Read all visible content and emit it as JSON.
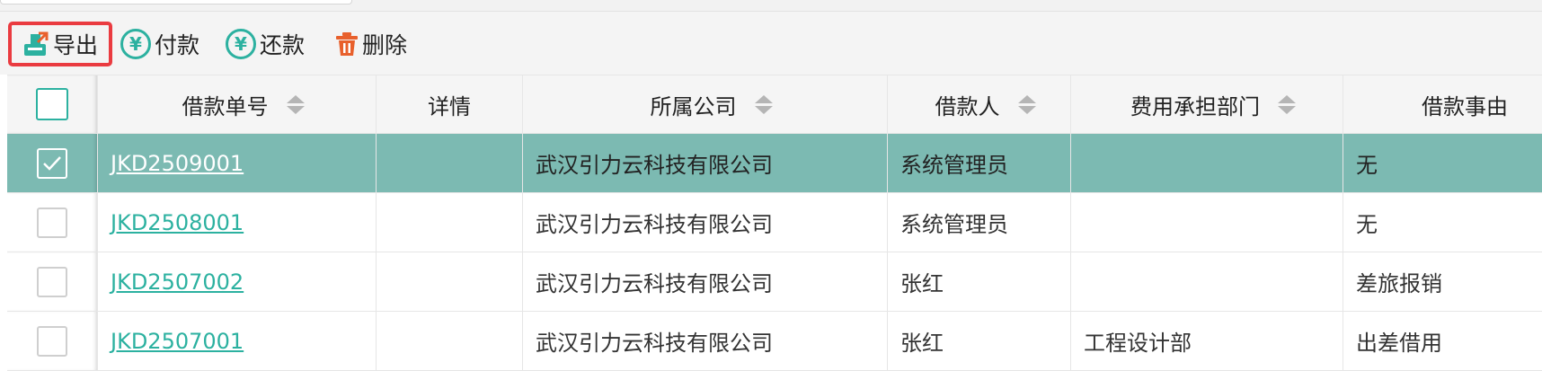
{
  "toolbar": {
    "export_label": "导出",
    "pay_label": "付款",
    "repay_label": "还款",
    "delete_label": "删除"
  },
  "table": {
    "headers": {
      "loan_no": "借款单号",
      "detail": "详情",
      "company": "所属公司",
      "borrower": "借款人",
      "dept": "费用承担部门",
      "reason": "借款事由"
    },
    "rows": [
      {
        "loan_no": "JKD2509001",
        "company": "武汉引力云科技有限公司",
        "borrower": "系统管理员",
        "dept": "",
        "reason": "无",
        "checked": true
      },
      {
        "loan_no": "JKD2508001",
        "company": "武汉引力云科技有限公司",
        "borrower": "系统管理员",
        "dept": "",
        "reason": "无",
        "checked": false
      },
      {
        "loan_no": "JKD2507002",
        "company": "武汉引力云科技有限公司",
        "borrower": "张红",
        "dept": "",
        "reason": "差旅报销",
        "checked": false
      },
      {
        "loan_no": "JKD2507001",
        "company": "武汉引力云科技有限公司",
        "borrower": "张红",
        "dept": "工程设计部",
        "reason": "出差借用",
        "checked": false
      }
    ]
  },
  "colors": {
    "accent": "#2cb1a0",
    "selected_row": "#7cbab2",
    "highlight_border": "#ea3b40",
    "delete_icon": "#e8602c"
  },
  "icons": {
    "export": "export-icon",
    "pay": "yen-icon",
    "repay": "yen-icon",
    "delete": "trash-icon"
  }
}
